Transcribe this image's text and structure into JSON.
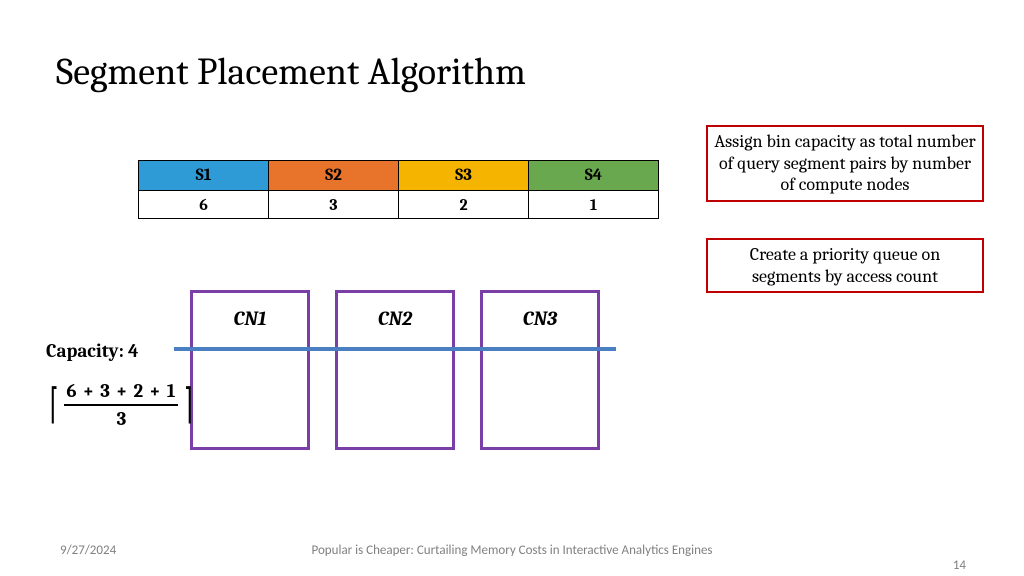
{
  "title": "Segment Placement Algorithm",
  "segments": {
    "headers": [
      "S1",
      "S2",
      "S3",
      "S4"
    ],
    "values": [
      "6",
      "3",
      "2",
      "1"
    ]
  },
  "callouts": {
    "c1": "Assign bin capacity as total number of query segment pairs by number of compute nodes",
    "c2": "Create a priority queue on segments by access count"
  },
  "bins": {
    "labels": [
      "CN1",
      "CN2",
      "CN3"
    ]
  },
  "capacity_label": "Capacity: 4",
  "math": {
    "numerator": "6 + 3 + 2 + 1",
    "denominator": "3"
  },
  "footer": {
    "date": "9/27/2024",
    "title": "Popular is Cheaper: Curtailing Memory Costs in Interactive Analytics Engines",
    "page": "14"
  }
}
